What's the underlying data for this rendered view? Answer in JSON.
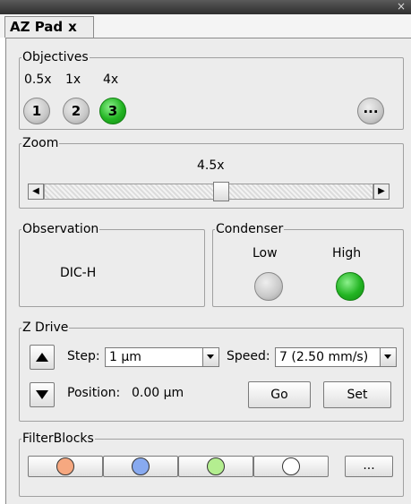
{
  "window": {
    "close_glyph": "×"
  },
  "tab": {
    "label": "AZ Pad",
    "close_label": "x"
  },
  "objectives": {
    "legend": "Objectives",
    "items": [
      {
        "mag": "0.5x",
        "number": "1",
        "active": false
      },
      {
        "mag": "1x",
        "number": "2",
        "active": false
      },
      {
        "mag": "4x",
        "number": "3",
        "active": true
      }
    ],
    "more_label": "..."
  },
  "zoom": {
    "legend": "Zoom",
    "value_label": "4.5x",
    "slider_level": 0.54
  },
  "observation": {
    "legend": "Observation",
    "value": "DIC-H"
  },
  "condenser": {
    "legend": "Condenser",
    "low_label": "Low",
    "high_label": "High",
    "selected": "High",
    "colors": {
      "inactive": "#c8c8c8",
      "active": "#22b422"
    }
  },
  "zdrive": {
    "legend": "Z Drive",
    "step_label": "Step:",
    "step_value": "1 µm",
    "speed_label": "Speed:",
    "speed_value": "7 (2.50 mm/s)",
    "position_label": "Position:",
    "position_value": "0.00 µm",
    "go_label": "Go",
    "set_label": "Set"
  },
  "filterblocks": {
    "legend": "FilterBlocks",
    "items": [
      {
        "color": "#f6a880",
        "icon": "orange-filter-circle-icon"
      },
      {
        "color": "#88aaf0",
        "icon": "blue-filter-circle-icon"
      },
      {
        "color": "#b4ee90",
        "icon": "green-filter-circle-icon"
      },
      {
        "color": "#ffffff",
        "icon": "empty-filter-circle-icon"
      }
    ],
    "more_label": "..."
  }
}
